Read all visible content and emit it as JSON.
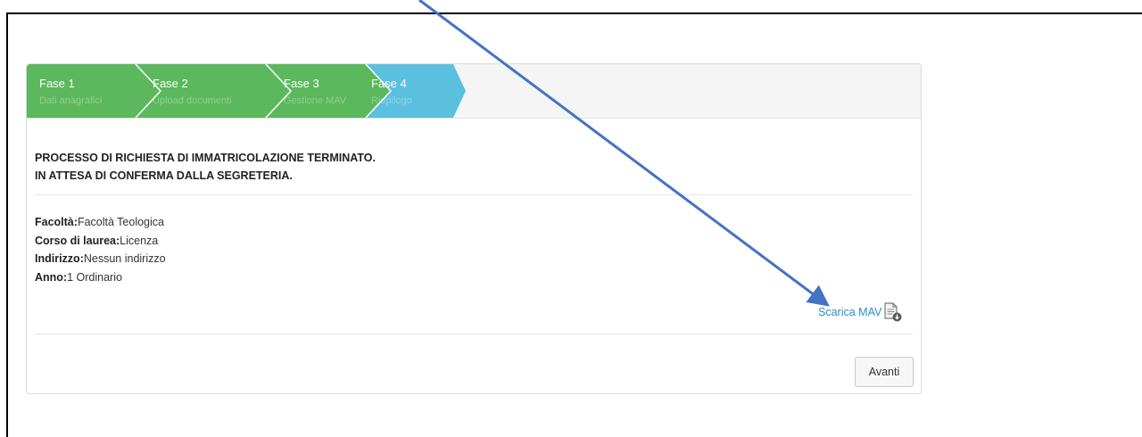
{
  "wizard": {
    "steps": [
      {
        "label": "Fase 1",
        "sub": "Dati anagrafici",
        "state": "done"
      },
      {
        "label": "Fase 2",
        "sub": "Upload documenti",
        "state": "done"
      },
      {
        "label": "Fase 3",
        "sub": "Gestione MAV",
        "state": "done"
      },
      {
        "label": "Fase 4",
        "sub": "Riepilogo",
        "state": "active"
      }
    ]
  },
  "message": {
    "line1": "PROCESSO DI RICHIESTA DI IMMATRICOLAZIONE TERMINATO.",
    "line2": "IN ATTESA DI CONFERMA DALLA SEGRETERIA."
  },
  "details": {
    "faculty_label": "Facoltà:",
    "faculty_value": "Facoltà Teologica",
    "course_label": "Corso di laurea:",
    "course_value": "Licenza",
    "address_label": "Indirizzo:",
    "address_value": "Nessun indirizzo",
    "year_label": "Anno:",
    "year_value": "1 Ordinario"
  },
  "download": {
    "label": "Scarica MAV",
    "icon": "document-download-icon"
  },
  "actions": {
    "next_label": "Avanti"
  },
  "colors": {
    "step_done": "#5cb85c",
    "step_active": "#5bc0de",
    "link": "#2a8bd0",
    "annotation_arrow": "#4472c4"
  }
}
